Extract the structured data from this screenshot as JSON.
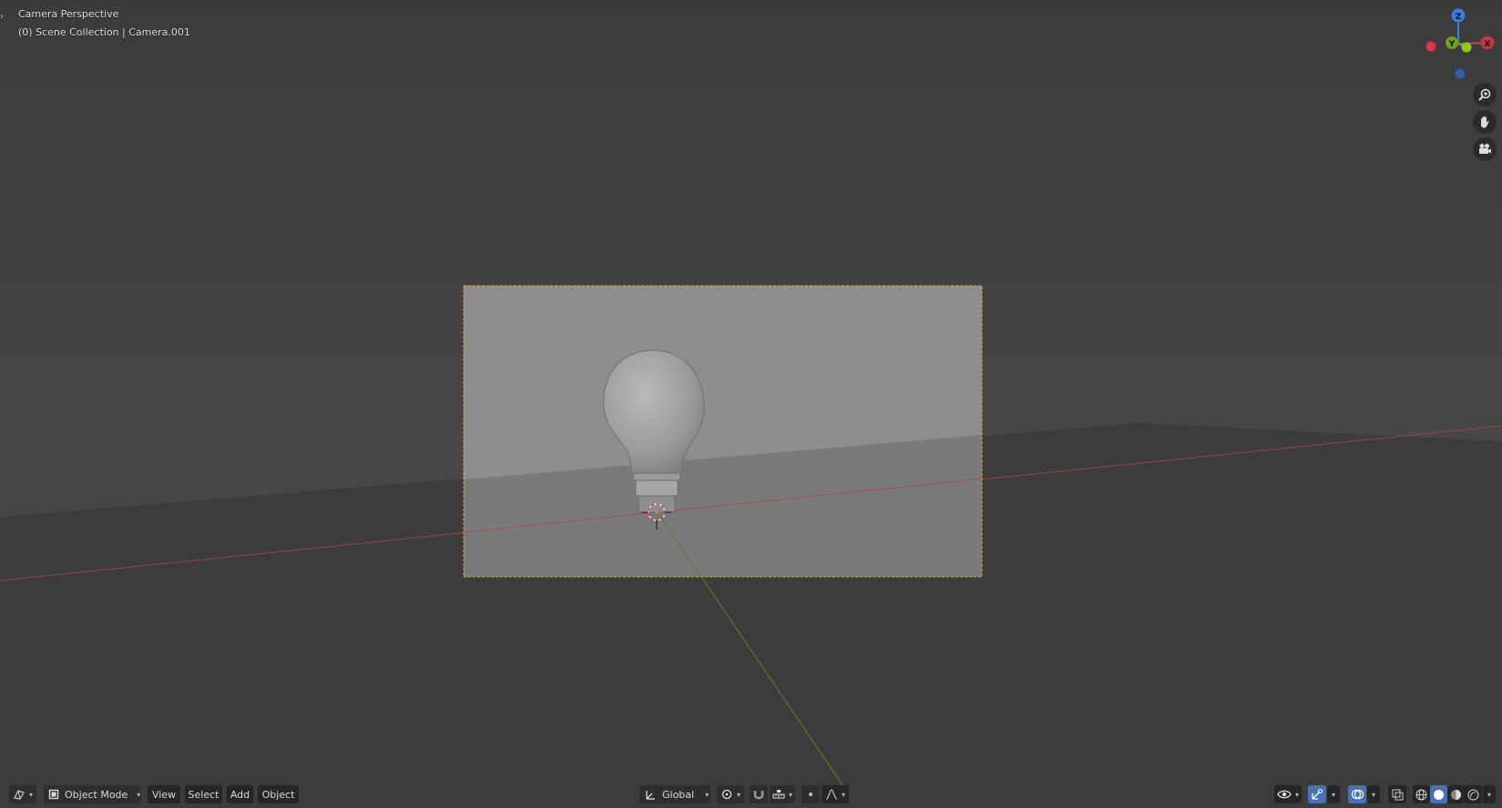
{
  "overlay": {
    "view_name": "Camera Perspective",
    "collection_info": "(0) Scene Collection | Camera.001"
  },
  "gizmo": {
    "axis_z": "Z",
    "axis_y": "Y",
    "axis_x": "X"
  },
  "header": {
    "mode": "Object Mode",
    "menus": {
      "view": "View",
      "select": "Select",
      "add": "Add",
      "object": "Object"
    },
    "orientation": "Global"
  },
  "colors": {
    "background": "#3d3d3d",
    "camera_frame": "#e0a030",
    "x_axis": "#c04040",
    "y_axis": "#7a9a20",
    "z_axis_blue": "#3a7de0",
    "active_button": "#4772b3"
  },
  "icons": {
    "editor_type": "view3d-icon",
    "mode": "object-mode-icon",
    "orientation": "orientation-icon",
    "pivot": "pivot-icon",
    "snap": "snap-magnet-icon",
    "snap_target": "snap-increment-icon",
    "proportional": "proportional-edit-icon",
    "falloff": "falloff-curve-icon",
    "visibility": "eye-icon",
    "gizmos": "gizmo-toggle-icon",
    "overlays": "overlay-toggle-icon",
    "xray": "xray-icon",
    "shading": [
      "wireframe-shading-icon",
      "solid-shading-icon",
      "material-shading-icon",
      "rendered-shading-icon"
    ],
    "nav": [
      "zoom-icon",
      "pan-hand-icon",
      "camera-view-icon"
    ]
  }
}
